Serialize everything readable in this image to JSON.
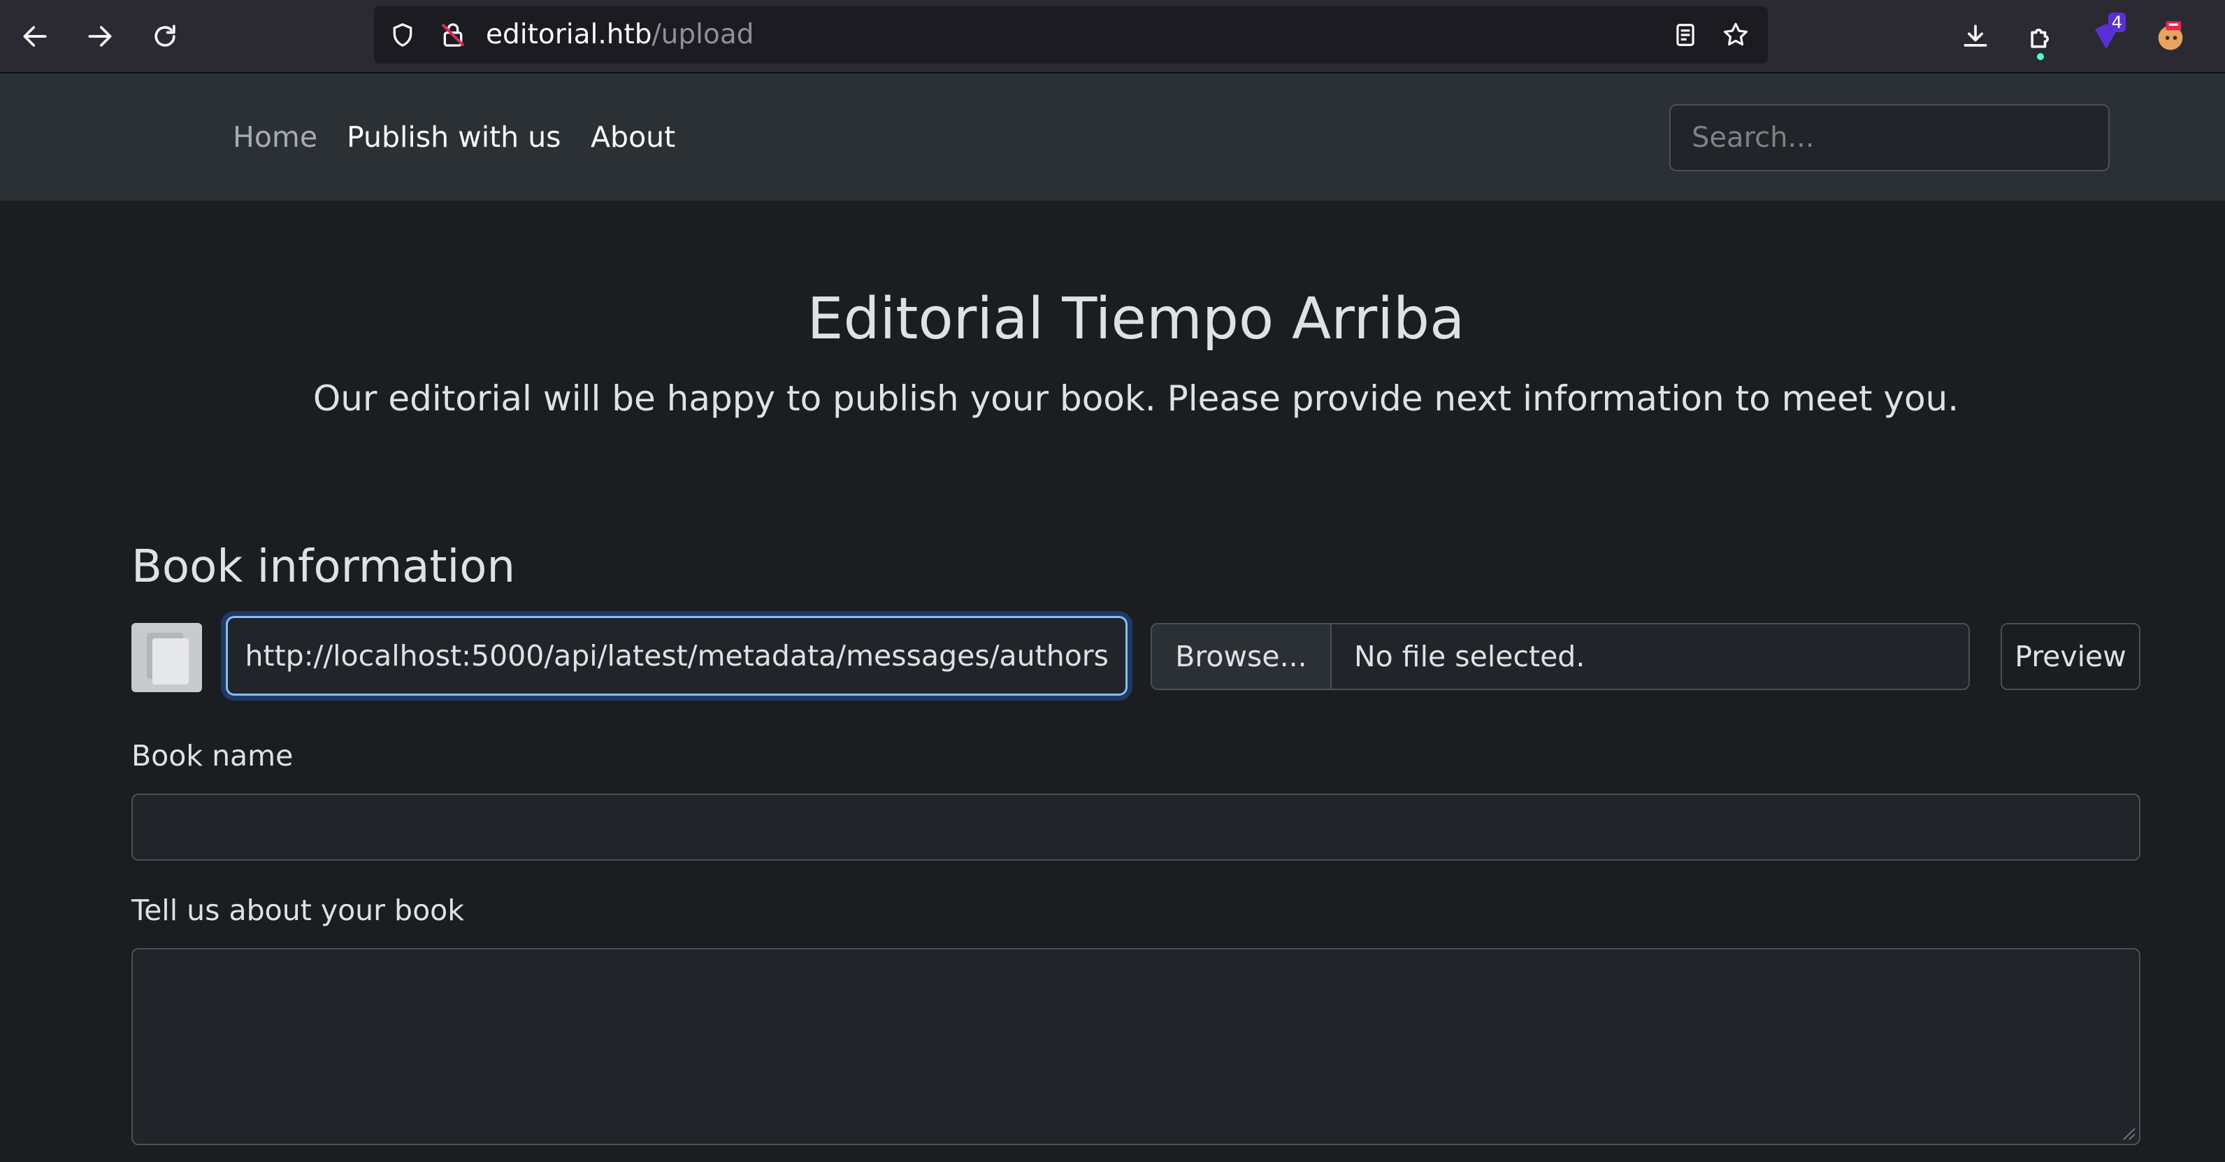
{
  "browser": {
    "url_host": "editorial.htb",
    "url_path": "/upload",
    "extension_badge": "4"
  },
  "navbar": {
    "links": [
      {
        "label": "Home"
      },
      {
        "label": "Publish with us"
      },
      {
        "label": "About"
      }
    ],
    "search_placeholder": "Search..."
  },
  "hero": {
    "title": "Editorial Tiempo Arriba",
    "subtitle": "Our editorial will be happy to publish your book. Please provide next information to meet you."
  },
  "book_info": {
    "heading": "Book information",
    "cover_url_value": "http://localhost:5000/api/latest/metadata/messages/authors",
    "browse_label": "Browse...",
    "file_status": "No file selected.",
    "preview_label": "Preview",
    "book_name_label": "Book name",
    "book_name_value": "",
    "about_label": "Tell us about your book",
    "about_value": ""
  },
  "colors": {
    "page_bg": "#1b1d20",
    "navbar_bg": "#2b3035",
    "focus_border": "#8bb9fe",
    "chrome_bg": "#2b2a33"
  }
}
